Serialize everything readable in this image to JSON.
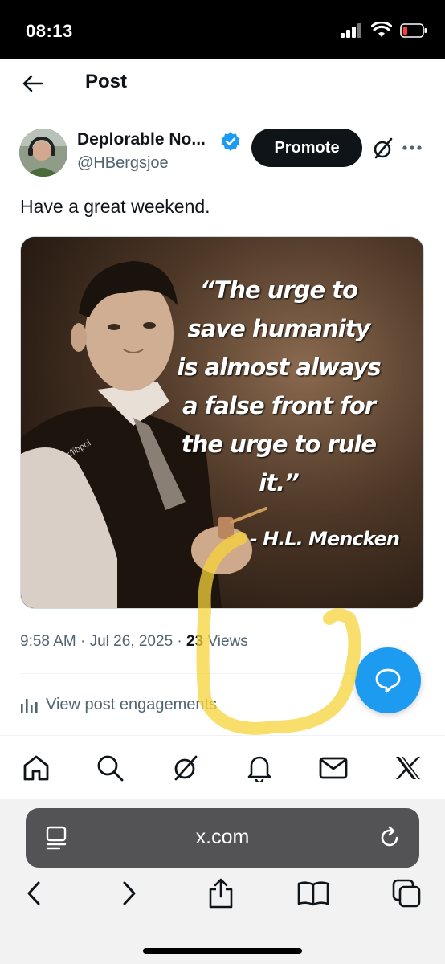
{
  "status_bar": {
    "time": "08:13"
  },
  "header": {
    "title": "Post"
  },
  "author": {
    "name": "Deplorable No...",
    "handle": "@HBergsjoe"
  },
  "actions": {
    "promote_label": "Promote"
  },
  "post": {
    "text": "Have a great weekend.",
    "image": {
      "quote_lines": [
        "“The urge to",
        "save humanity",
        "is almost always",
        "a false front for",
        "the urge to rule it.”"
      ],
      "attribution": "- H.L. Mencken",
      "watermark": "r/libpol"
    },
    "time": "9:58 AM",
    "date": "Jul 26, 2025",
    "views_count": "23",
    "views_label": "Views",
    "engagements_label": "View post engagements"
  },
  "tab_bar": {
    "items": [
      "home-icon",
      "search-icon",
      "grok-icon",
      "notifications-icon",
      "messages-icon",
      "x-logo-icon"
    ]
  },
  "safari": {
    "url": "x.com"
  },
  "colors": {
    "accent": "#1d9bf0",
    "highlighter": "#f5d33a",
    "text_secondary": "#536471"
  }
}
